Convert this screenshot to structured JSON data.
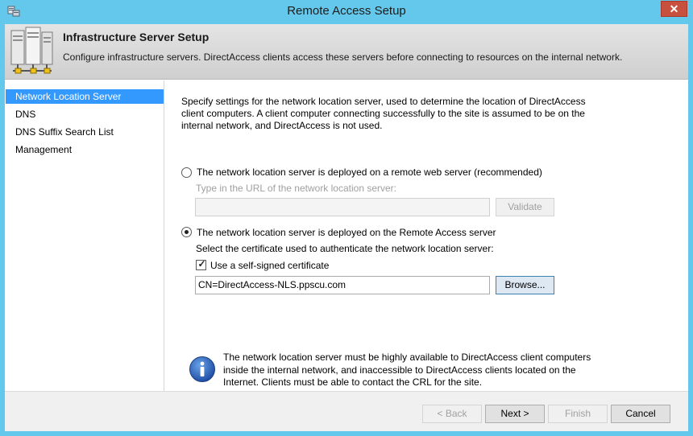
{
  "window": {
    "title": "Remote Access Setup",
    "close_label": "✕",
    "accent_color": "#63c8eb"
  },
  "banner": {
    "title": "Infrastructure Server Setup",
    "description": "Configure infrastructure servers. DirectAccess clients access these servers before connecting to resources on the internal network.",
    "icon": "server-icon"
  },
  "sidebar": {
    "items": [
      {
        "label": "Network Location Server",
        "selected": true
      },
      {
        "label": "DNS",
        "selected": false
      },
      {
        "label": "DNS Suffix Search List",
        "selected": false
      },
      {
        "label": "Management",
        "selected": false
      }
    ]
  },
  "content": {
    "intro": "Specify settings for the network location server, used to determine the location of DirectAccess client computers. A client computer connecting successfully to the site is assumed to be on the internal network, and DirectAccess is not used.",
    "option_remote": {
      "label": "The network location server is deployed on a remote web server (recommended)",
      "selected": false,
      "url_prompt": "Type in the URL of the network location server:",
      "url_value": "",
      "validate_label": "Validate"
    },
    "option_local": {
      "label": "The network location server is deployed on the Remote Access server",
      "selected": true,
      "cert_prompt": "Select the certificate used to authenticate the network location server:",
      "self_signed_label": "Use a self-signed certificate",
      "self_signed_checked": true,
      "cert_value": "CN=DirectAccess-NLS.ppscu.com",
      "browse_label": "Browse..."
    },
    "info": {
      "icon": "info-icon",
      "text": "The network location server must be highly available to DirectAccess client computers inside the internal network, and inaccessible to DirectAccess clients located on the Internet. Clients must be able to contact the CRL for the site."
    }
  },
  "footer": {
    "back_label": "< Back",
    "next_label": "Next >",
    "finish_label": "Finish",
    "cancel_label": "Cancel"
  }
}
